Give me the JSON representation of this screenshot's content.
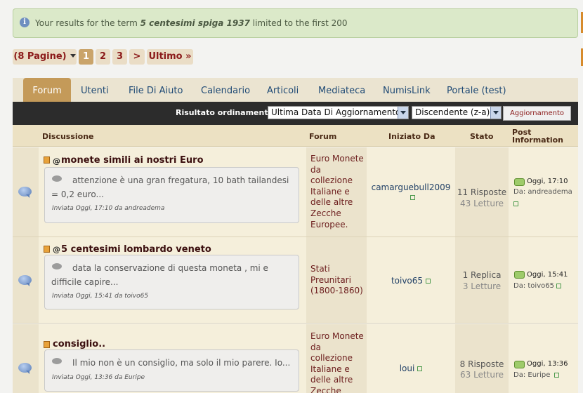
{
  "notice": {
    "prefix": "Your results for the term ",
    "term": "5 centesimi spiga 1937",
    "suffix": " limited to the first 200"
  },
  "pagination": {
    "pages_label": "(8 Pagine)",
    "pages": [
      "1",
      "2",
      "3"
    ],
    "current": "1",
    "next": ">",
    "last": "Ultimo »"
  },
  "tabs": [
    "Forum",
    "Utenti",
    "File Di Aiuto",
    "Calendario",
    "Articoli",
    "Mediateca",
    "NumisLink",
    "Portale (test)"
  ],
  "sort": {
    "label": "Risultato ordinamento",
    "field_value": "Ultima Data Di Aggiornamento",
    "order_value": "Discendente (z-a)",
    "button": "Aggiornamento"
  },
  "columns": {
    "discussion": "Discussione",
    "forum": "Forum",
    "started_by": "Iniziato Da",
    "status": "Stato",
    "post_info": "Post Information"
  },
  "rows": [
    {
      "attach_icon": "@",
      "title": "monete simili ai nostri Euro",
      "snippet": "attenzione è una gran fregatura, 10 bath tailandesi = 0,2 euro...",
      "meta": "Inviata Oggi, 17:10 da andreadema",
      "forum": "Euro Monete da collezione Italiane e delle altre Zecche Europee.",
      "starter": "camarguebull2009",
      "replies": "11 Risposte",
      "views": "43 Letture",
      "last_time": "Oggi, 17:10",
      "last_by": "Da: andreadema"
    },
    {
      "attach_icon": "@",
      "title": "5 centesimi lombardo veneto",
      "snippet": "data la conservazione di questa moneta , mi e difficile capire...",
      "meta": "Inviata Oggi, 15:41 da toivo65",
      "forum": "Stati Preunitari (1800-1860)",
      "starter": "toivo65",
      "replies": "1 Replica",
      "views": "3 Letture",
      "last_time": "Oggi, 15:41",
      "last_by": "Da: toivo65"
    },
    {
      "title": "consiglio..",
      "snippet": "Il mio non è un consiglio, ma solo il mio parere. Io...",
      "meta": "Inviata Oggi, 13:36 da Euripe",
      "forum": "Euro Monete da collezione Italiane e delle altre Zecche",
      "starter": "loui",
      "replies": "8 Risposte",
      "views": "63 Letture",
      "last_time": "Oggi, 13:36",
      "last_by": "Da: Euripe"
    }
  ]
}
